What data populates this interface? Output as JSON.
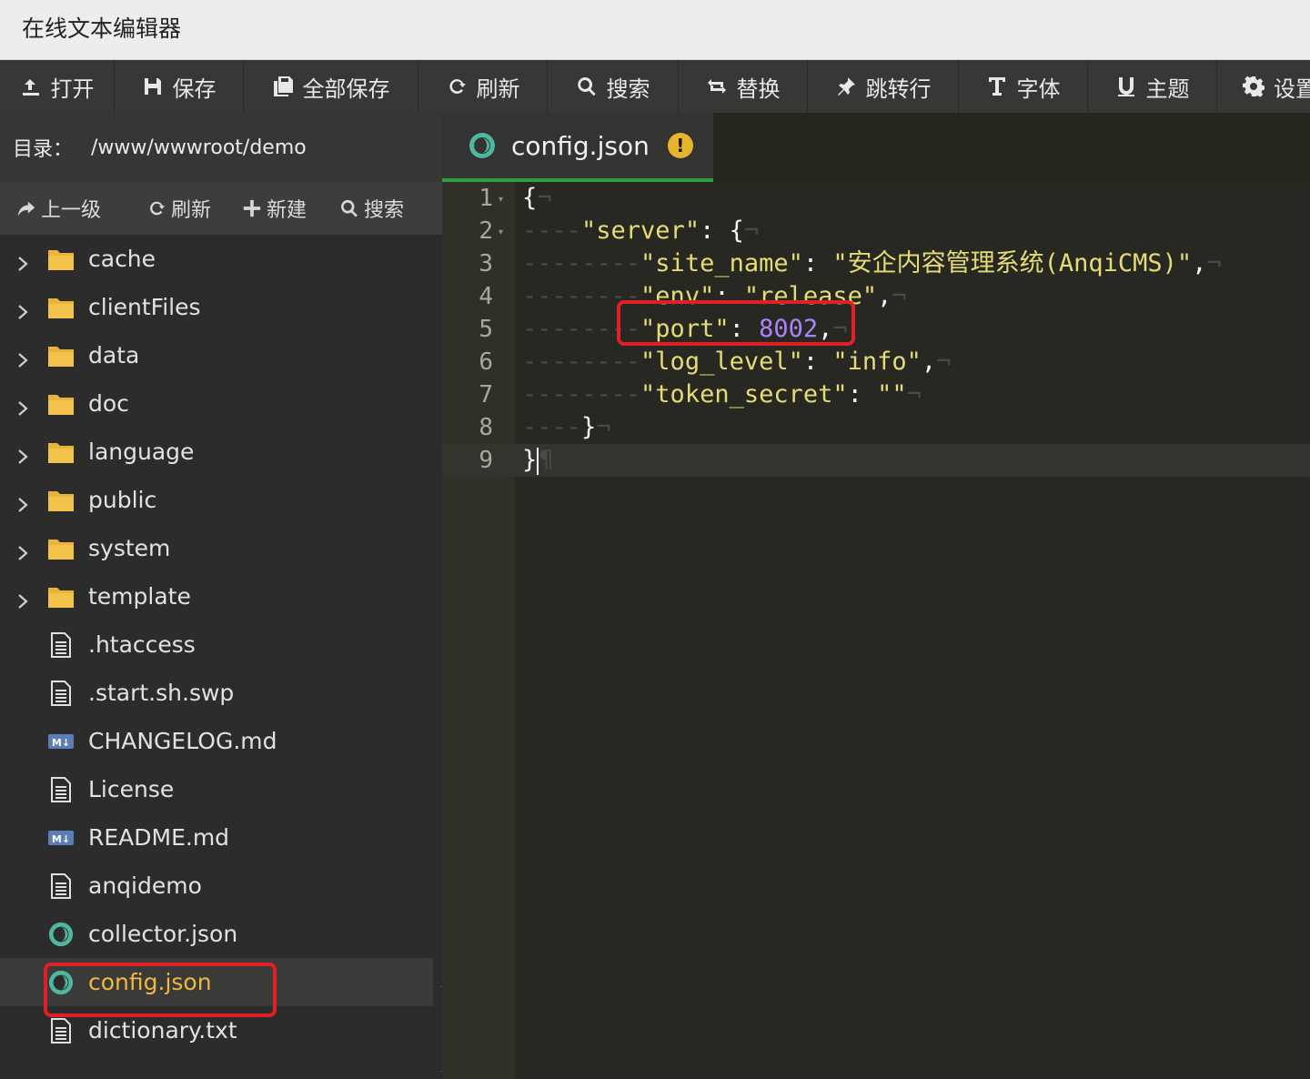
{
  "window": {
    "title": "在线文本编辑器"
  },
  "toolbar": {
    "buttons": [
      {
        "label": "打开",
        "icon": "upload-icon"
      },
      {
        "label": "保存",
        "icon": "save-icon"
      },
      {
        "label": "全部保存",
        "icon": "save-all-icon"
      },
      {
        "label": "刷新",
        "icon": "refresh-icon"
      },
      {
        "label": "搜索",
        "icon": "search-icon"
      },
      {
        "label": "替换",
        "icon": "replace-icon"
      },
      {
        "label": "跳转行",
        "icon": "pin-icon"
      },
      {
        "label": "字体",
        "icon": "font-icon"
      },
      {
        "label": "主题",
        "icon": "theme-icon"
      },
      {
        "label": "设置",
        "icon": "gear-icon"
      }
    ]
  },
  "sidebar": {
    "dir_label": "目录：",
    "dir_path": "/www/wwwroot/demo",
    "actions": [
      {
        "label": "上一级",
        "icon": "up-level-icon"
      },
      {
        "label": "刷新",
        "icon": "refresh-icon"
      },
      {
        "label": "新建",
        "icon": "plus-icon"
      },
      {
        "label": "搜索",
        "icon": "search-icon"
      }
    ],
    "files": [
      {
        "name": "cache",
        "type": "folder"
      },
      {
        "name": "clientFiles",
        "type": "folder"
      },
      {
        "name": "data",
        "type": "folder"
      },
      {
        "name": "doc",
        "type": "folder"
      },
      {
        "name": "language",
        "type": "folder"
      },
      {
        "name": "public",
        "type": "folder"
      },
      {
        "name": "system",
        "type": "folder"
      },
      {
        "name": "template",
        "type": "folder"
      },
      {
        "name": ".htaccess",
        "type": "text"
      },
      {
        "name": ".start.sh.swp",
        "type": "text"
      },
      {
        "name": "CHANGELOG.md",
        "type": "markdown"
      },
      {
        "name": "License",
        "type": "text"
      },
      {
        "name": "README.md",
        "type": "markdown"
      },
      {
        "name": "anqidemo",
        "type": "text"
      },
      {
        "name": "collector.json",
        "type": "json"
      },
      {
        "name": "config.json",
        "type": "json",
        "selected": true
      },
      {
        "name": "dictionary.txt",
        "type": "text"
      }
    ]
  },
  "editor": {
    "tab": {
      "name": "config.json",
      "warning": "!"
    },
    "lines": [
      {
        "n": "1",
        "fold": true
      },
      {
        "n": "2",
        "fold": true
      },
      {
        "n": "3"
      },
      {
        "n": "4"
      },
      {
        "n": "5"
      },
      {
        "n": "6"
      },
      {
        "n": "7"
      },
      {
        "n": "8"
      },
      {
        "n": "9",
        "active": true
      }
    ],
    "code": {
      "l1": "{",
      "l2_key": "\"server\"",
      "l2_rest": ": {",
      "l3_key": "\"site_name\"",
      "l3_val": "\"安企内容管理系统(AnqiCMS)\"",
      "l4_key": "\"env\"",
      "l4_val": "\"release\"",
      "l5_key": "\"port\"",
      "l5_val": "8002",
      "l6_key": "\"log_level\"",
      "l6_val": "\"info\"",
      "l7_key": "\"token_secret\"",
      "l7_val": "\"\"",
      "l8": "}",
      "l9": "}"
    }
  },
  "colors": {
    "highlight_border": "#e01f26",
    "selected_file": "#f0b840",
    "string": "#e6db74",
    "number": "#ae81ff",
    "tab_underline": "#2ea043"
  }
}
